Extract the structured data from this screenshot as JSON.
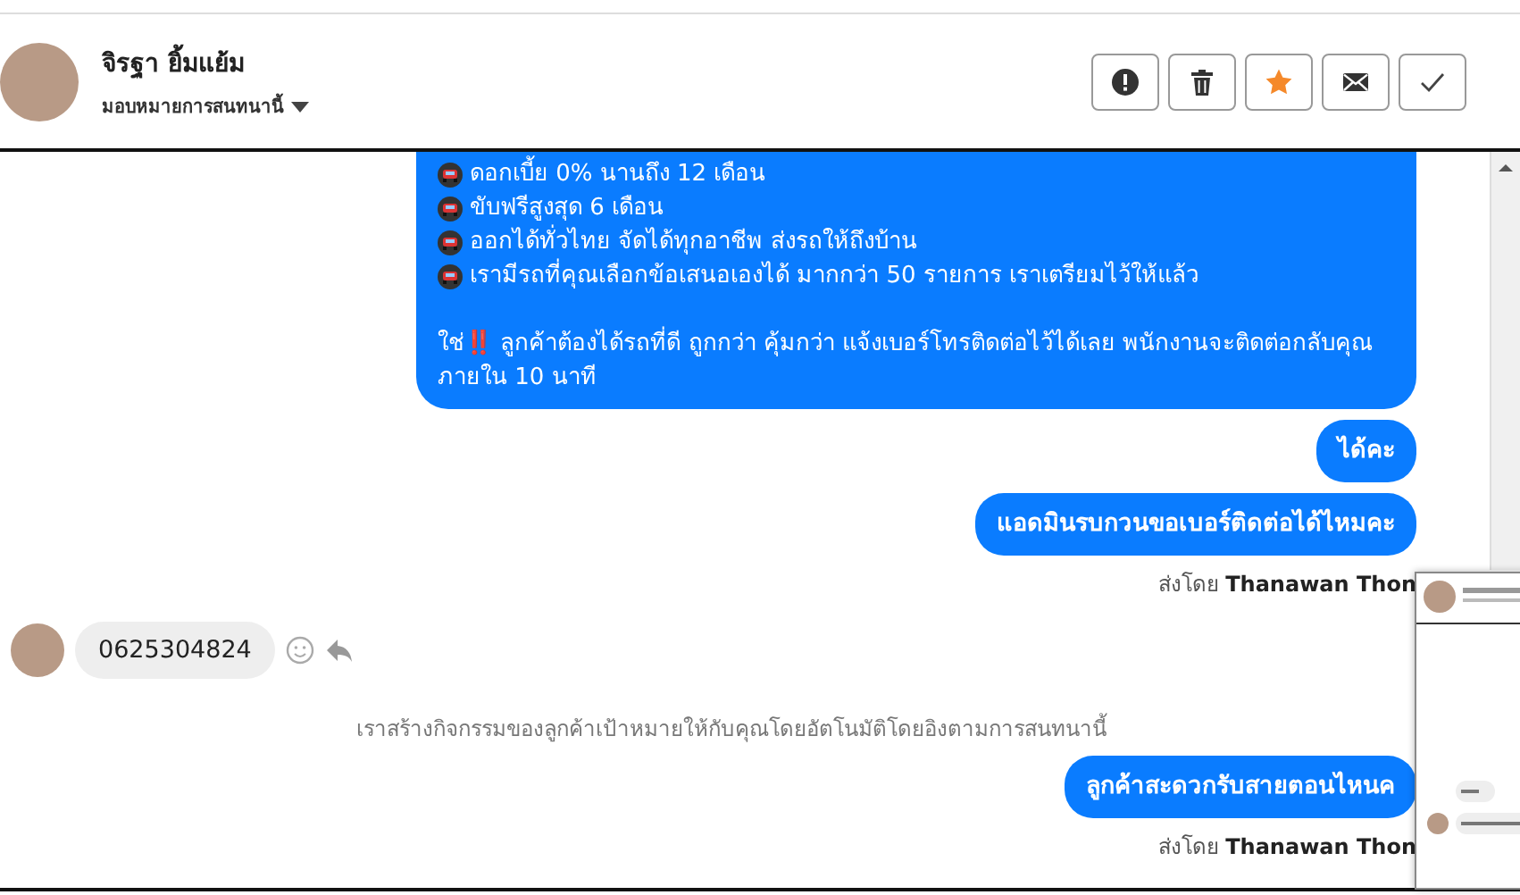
{
  "header": {
    "contact_name": "จิรฐา ยิ้มแย้ม",
    "assign_label": "มอบหมายการสนทนานี้",
    "starred": true,
    "actions": [
      {
        "kind": "alert"
      },
      {
        "kind": "trash"
      },
      {
        "kind": "star"
      },
      {
        "kind": "mail"
      },
      {
        "kind": "check"
      }
    ]
  },
  "messages": [
    {
      "kind": "outgoing",
      "bullets": [
        "ดอกเบี้ย 0% นานถึง 12 เดือน",
        "ขับฟรีสูงสุด 6 เดือน",
        "ออกได้ทั่วไทย จัดได้ทุกอาชีพ ส่งรถให้ถึงบ้าน",
        "เรามีรถที่คุณเลือกข้อเสนอเองได้ มากกว่า 50 รายการ เราเตรียมไว้ให้แล้ว"
      ],
      "text": "ใช่‼️ ลูกค้าต้องได้รถที่ดี ถูกกว่า คุ้มกว่า แจ้งเบอร์โทรติดต่อไว้ได้เลย พนักงานจะติดต่อกลับคุณภายใน 10 นาที"
    },
    {
      "kind": "outgoing",
      "text": "ได้คะ"
    },
    {
      "kind": "outgoing",
      "text": "แอดมินรบกวนขอเบอร์ติดต่อได้ไหมคะ"
    },
    {
      "kind": "sent_by",
      "label": "ส่งโดย",
      "name": "Thanawan Thon"
    },
    {
      "kind": "incoming",
      "text": "0625304824"
    },
    {
      "kind": "system",
      "text": "เราสร้างกิจกรรมของลูกค้าเป้าหมายให้กับคุณโดยอัตโนมัติโดยอิงตามการสนทนานี้"
    },
    {
      "kind": "outgoing",
      "text": "ลูกค้าสะดวกรับสายตอนไหนค"
    },
    {
      "kind": "sent_by",
      "label": "ส่งโดย",
      "name": "Thanawan Thon"
    }
  ]
}
